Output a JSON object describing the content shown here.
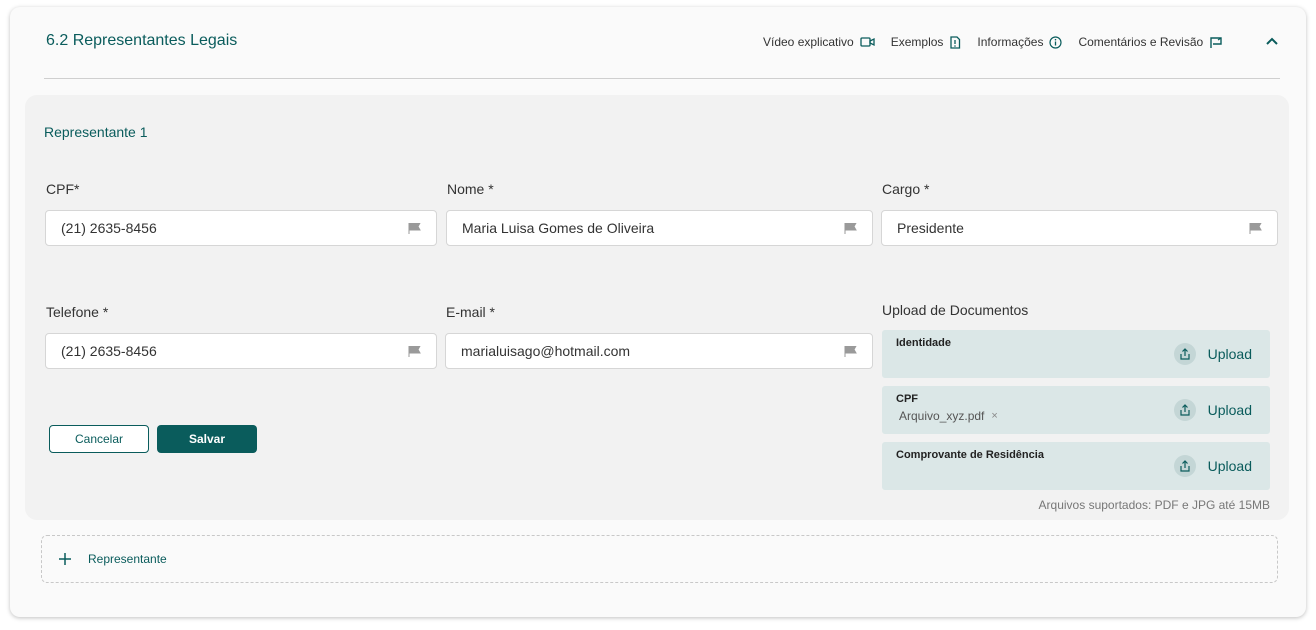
{
  "section": {
    "title": "6.2 Representantes Legais"
  },
  "header_actions": [
    {
      "label": "Vídeo explicativo",
      "icon": "video-icon"
    },
    {
      "label": "Exemplos",
      "icon": "document-icon"
    },
    {
      "label": "Informações",
      "icon": "info-icon"
    },
    {
      "label": "Comentários e Revisão",
      "icon": "comment-flag-icon"
    }
  ],
  "representative": {
    "title": "Representante 1",
    "fields": {
      "cpf": {
        "label": "CPF*",
        "value": "(21) 2635-8456"
      },
      "nome": {
        "label": "Nome *",
        "value": "Maria Luisa Gomes de Oliveira"
      },
      "cargo": {
        "label": "Cargo *",
        "value": "Presidente"
      },
      "telefone": {
        "label": "Telefone *",
        "value": "(21) 2635-8456"
      },
      "email": {
        "label": "E-mail *",
        "value": "marialuisago@hotmail.com"
      }
    },
    "buttons": {
      "cancel": "Cancelar",
      "save": "Salvar"
    },
    "uploads": {
      "label": "Upload de Documentos",
      "upload_label": "Upload",
      "documents": [
        {
          "name": "Identidade",
          "file": ""
        },
        {
          "name": "CPF",
          "file": "Arquivo_xyz.pdf"
        },
        {
          "name": "Comprovante de Residência",
          "file": ""
        }
      ],
      "remove_glyph": "×",
      "supported": "Arquivos suportados: PDF e JPG até 15MB"
    }
  },
  "add_representative": {
    "label": "Representante"
  },
  "colors": {
    "accent": "#0a5c5c",
    "upload_bg": "#dbe7e7",
    "panel_bg": "#f2f2f2"
  }
}
